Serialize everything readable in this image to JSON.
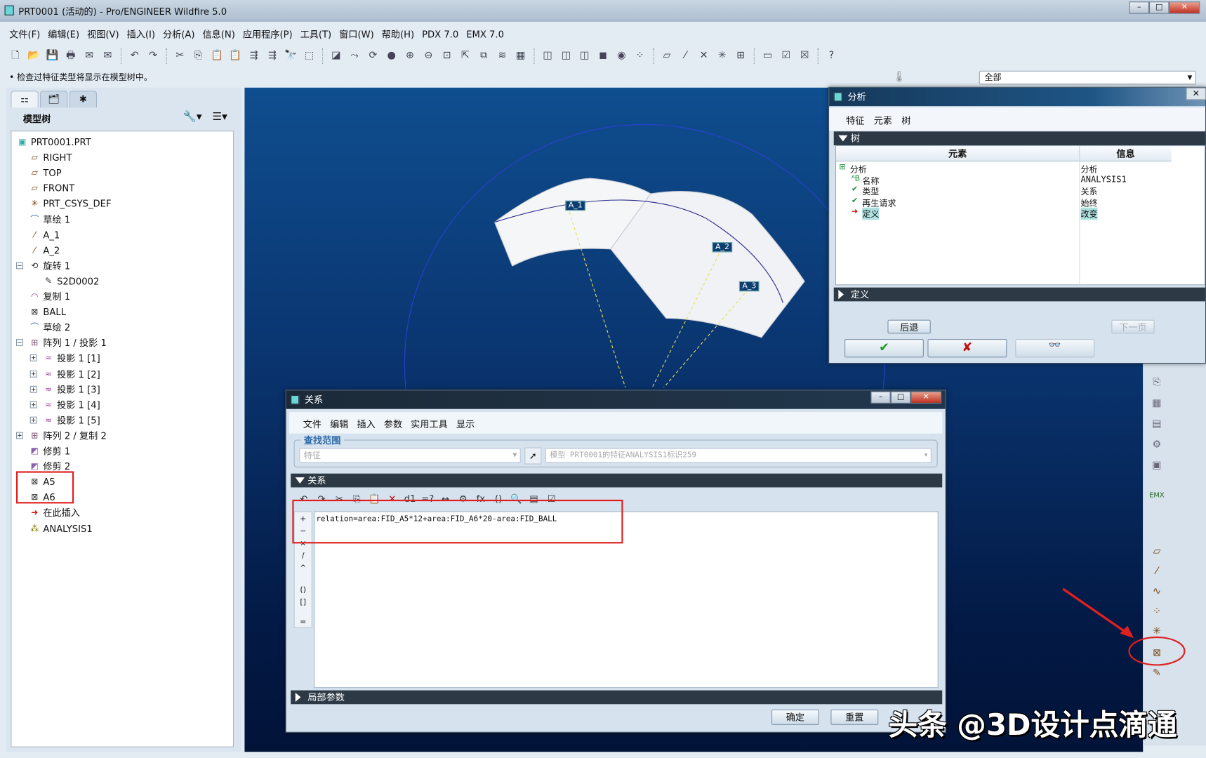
{
  "window": {
    "title": "PRT0001 (活动的) - Pro/ENGINEER Wildfire 5.0",
    "min": "–",
    "max": "□",
    "close": "✕"
  },
  "menu": [
    "文件(F)",
    "编辑(E)",
    "视图(V)",
    "插入(I)",
    "分析(A)",
    "信息(N)",
    "应用程序(P)",
    "工具(T)",
    "窗口(W)",
    "帮助(H)",
    "PDX 7.0",
    "EMX 7.0"
  ],
  "toolbar": {
    "icons": [
      "new",
      "open",
      "save",
      "print",
      "email",
      "email-attach",
      "|",
      "undo",
      "redo",
      "|",
      "cut",
      "copy",
      "paste",
      "paste-special",
      "regen",
      "regen-manager",
      "find",
      "select-box",
      "|",
      "orient",
      "datum-display",
      "spin",
      "shade",
      "zoom-in",
      "zoom-out",
      "refit",
      "reorient",
      "saved-views",
      "layers",
      "view-manager",
      "|",
      "wireframe",
      "hidden-line",
      "no-hidden",
      "shading",
      "enhanced",
      "datum-toggle",
      "|",
      "plane-display",
      "axis-display",
      "point-display",
      "csys-display",
      "annotation-display",
      "|",
      "window",
      "activate",
      "close",
      "|",
      "context-help"
    ]
  },
  "status": {
    "message": "• 检查过特征类型将显示在模型树中。",
    "filter": "全部"
  },
  "left_panel": {
    "header": "模型树",
    "tree": [
      {
        "label": "PRT0001.PRT",
        "level": 0,
        "icon": "part-icon",
        "glyph": "▣"
      },
      {
        "label": "RIGHT",
        "level": 1,
        "icon": "datum-plane-icon",
        "glyph": "▱"
      },
      {
        "label": "TOP",
        "level": 1,
        "icon": "datum-plane-icon",
        "glyph": "▱"
      },
      {
        "label": "FRONT",
        "level": 1,
        "icon": "datum-plane-icon",
        "glyph": "▱"
      },
      {
        "label": "PRT_CSYS_DEF",
        "level": 1,
        "icon": "csys-icon",
        "glyph": "✳"
      },
      {
        "label": "草绘 1",
        "level": 1,
        "icon": "sketch-icon",
        "glyph": "⌒"
      },
      {
        "label": "A_1",
        "level": 1,
        "icon": "axis-icon",
        "glyph": "⁄"
      },
      {
        "label": "A_2",
        "level": 1,
        "icon": "axis-icon",
        "glyph": "⁄"
      },
      {
        "label": "旋转 1",
        "level": 1,
        "icon": "revolve-icon",
        "glyph": "⟲",
        "expander": "−"
      },
      {
        "label": "S2D0002",
        "level": 2,
        "icon": "sketch-section-icon",
        "glyph": "✎"
      },
      {
        "label": "复制 1",
        "level": 1,
        "icon": "copy-surface-icon",
        "glyph": "◠"
      },
      {
        "label": "BALL",
        "level": 1,
        "icon": "analysis-feature-icon",
        "glyph": "⊠"
      },
      {
        "label": "草绘 2",
        "level": 1,
        "icon": "sketch-icon",
        "glyph": "⌒"
      },
      {
        "label": "阵列 1 / 投影 1",
        "level": 1,
        "icon": "pattern-icon",
        "glyph": "⊞",
        "expander": "−"
      },
      {
        "label": "投影 1 [1]",
        "level": 2,
        "icon": "projection-icon",
        "glyph": "≈",
        "expander": "+"
      },
      {
        "label": "投影 1 [2]",
        "level": 2,
        "icon": "projection-icon",
        "glyph": "≈",
        "expander": "+"
      },
      {
        "label": "投影 1 [3]",
        "level": 2,
        "icon": "projection-icon",
        "glyph": "≈",
        "expander": "+"
      },
      {
        "label": "投影 1 [4]",
        "level": 2,
        "icon": "projection-icon",
        "glyph": "≈",
        "expander": "+"
      },
      {
        "label": "投影 1 [5]",
        "level": 2,
        "icon": "projection-icon",
        "glyph": "≈",
        "expander": "+"
      },
      {
        "label": "阵列 2 / 复制 2",
        "level": 1,
        "icon": "pattern-icon",
        "glyph": "⊞",
        "expander": "+"
      },
      {
        "label": "修剪 1",
        "level": 1,
        "icon": "trim-icon",
        "glyph": "◩"
      },
      {
        "label": "修剪 2",
        "level": 1,
        "icon": "trim-icon",
        "glyph": "◩"
      },
      {
        "label": "A5",
        "level": 1,
        "icon": "analysis-feature-icon",
        "glyph": "⊠"
      },
      {
        "label": "A6",
        "level": 1,
        "icon": "analysis-feature-icon",
        "glyph": "⊠"
      },
      {
        "label": "在此插入",
        "level": 1,
        "icon": "insert-here-icon",
        "glyph": "➜"
      },
      {
        "label": "ANALYSIS1",
        "level": 1,
        "icon": "analysis-icon",
        "glyph": "⁂"
      }
    ]
  },
  "viewport": {
    "labels": [
      "A_1",
      "A_2",
      "A_3"
    ]
  },
  "analysis_dialog": {
    "title": "分析",
    "tabs": [
      "特征",
      "元素",
      "树"
    ],
    "tree_section": "树",
    "col_element": "元素",
    "col_info": "信息",
    "rows": [
      {
        "element": "分析",
        "info": "分析"
      },
      {
        "element": "名称",
        "info": "ANALYSIS1"
      },
      {
        "element": "类型",
        "info": "关系"
      },
      {
        "element": "再生请求",
        "info": "始终"
      },
      {
        "element": "定义",
        "info": "改变"
      }
    ],
    "define_section": "定义",
    "back": "后退",
    "next": "下一页",
    "ok": "✔",
    "cancel": "✘",
    "preview": "👓"
  },
  "relations_dialog": {
    "title": "关系",
    "menu": [
      "文件",
      "编辑",
      "插入",
      "参数",
      "实用工具",
      "显示"
    ],
    "scope_label": "查找范围",
    "scope_type": "特征",
    "scope_value": "模型 PRT0001的特征ANALYSIS1标识259",
    "section": "关系",
    "tools": [
      "↶",
      "↷",
      "✂",
      "⎘",
      "📋",
      "✕",
      "d1",
      "=?",
      "↔",
      "⚙",
      "fx",
      "()",
      "🔍",
      "▤",
      "☑"
    ],
    "side_ops": [
      "+",
      "−",
      "×",
      "/",
      "^",
      "()",
      "[]",
      "="
    ],
    "text": "relation=area:FID_A5*12+area:FID_A6*20-area:FID_BALL",
    "local_params": "局部参数",
    "ok": "确定",
    "reset": "重置"
  },
  "right_toolbar": {
    "icons": [
      "datum-plane",
      "datum-axis",
      "datum-curve",
      "datum-point",
      "csys",
      "analysis-feature",
      "sketch",
      "emx"
    ]
  },
  "watermark": "头条 @3D设计点滴通",
  "colors": {
    "highlight": "#e02020",
    "viewport": "#0a3570"
  }
}
